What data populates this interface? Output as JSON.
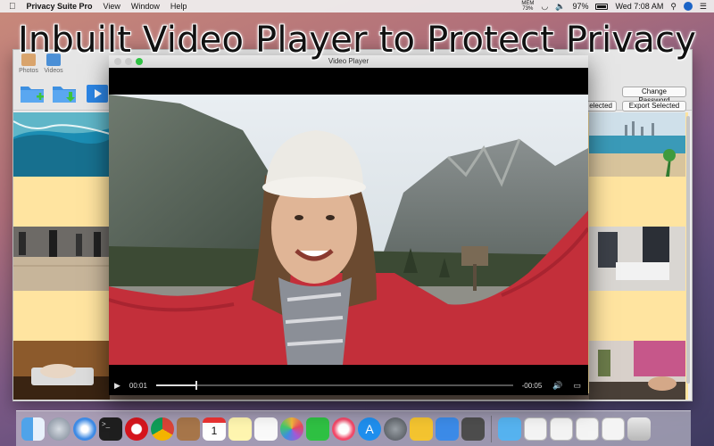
{
  "menubar": {
    "app_name": "Privacy Suite Pro",
    "menus": [
      "View",
      "Window",
      "Help"
    ],
    "status_top": "MEM",
    "status_pct": "73%",
    "battery": "97%",
    "clock": "Wed 7:08 AM"
  },
  "headline": "Inbuilt Video Player to Protect Privacy",
  "app": {
    "tabs": [
      "Photos",
      "Videos"
    ],
    "change_password": "Change Password",
    "selected_partial": "elected",
    "export_selected": "Export Selected"
  },
  "player": {
    "title": "Video Player",
    "elapsed": "00:01",
    "remaining": "-00:05",
    "progress": 0.11
  },
  "dock": {
    "apps": [
      "finder",
      "launchpad",
      "safari",
      "terminal",
      "opera",
      "chrome",
      "contacts",
      "calendar",
      "notes",
      "reminders",
      "photos",
      "facetime",
      "itunes",
      "app-store",
      "system-preferences",
      "privacy-suite",
      "xcode",
      "preview",
      "folder",
      "doc1",
      "doc2",
      "doc3",
      "doc4",
      "trash"
    ],
    "calendar_day": "1"
  },
  "colors": {
    "accent": "#1b63c6",
    "grid_bg": "#ffe4a0"
  }
}
